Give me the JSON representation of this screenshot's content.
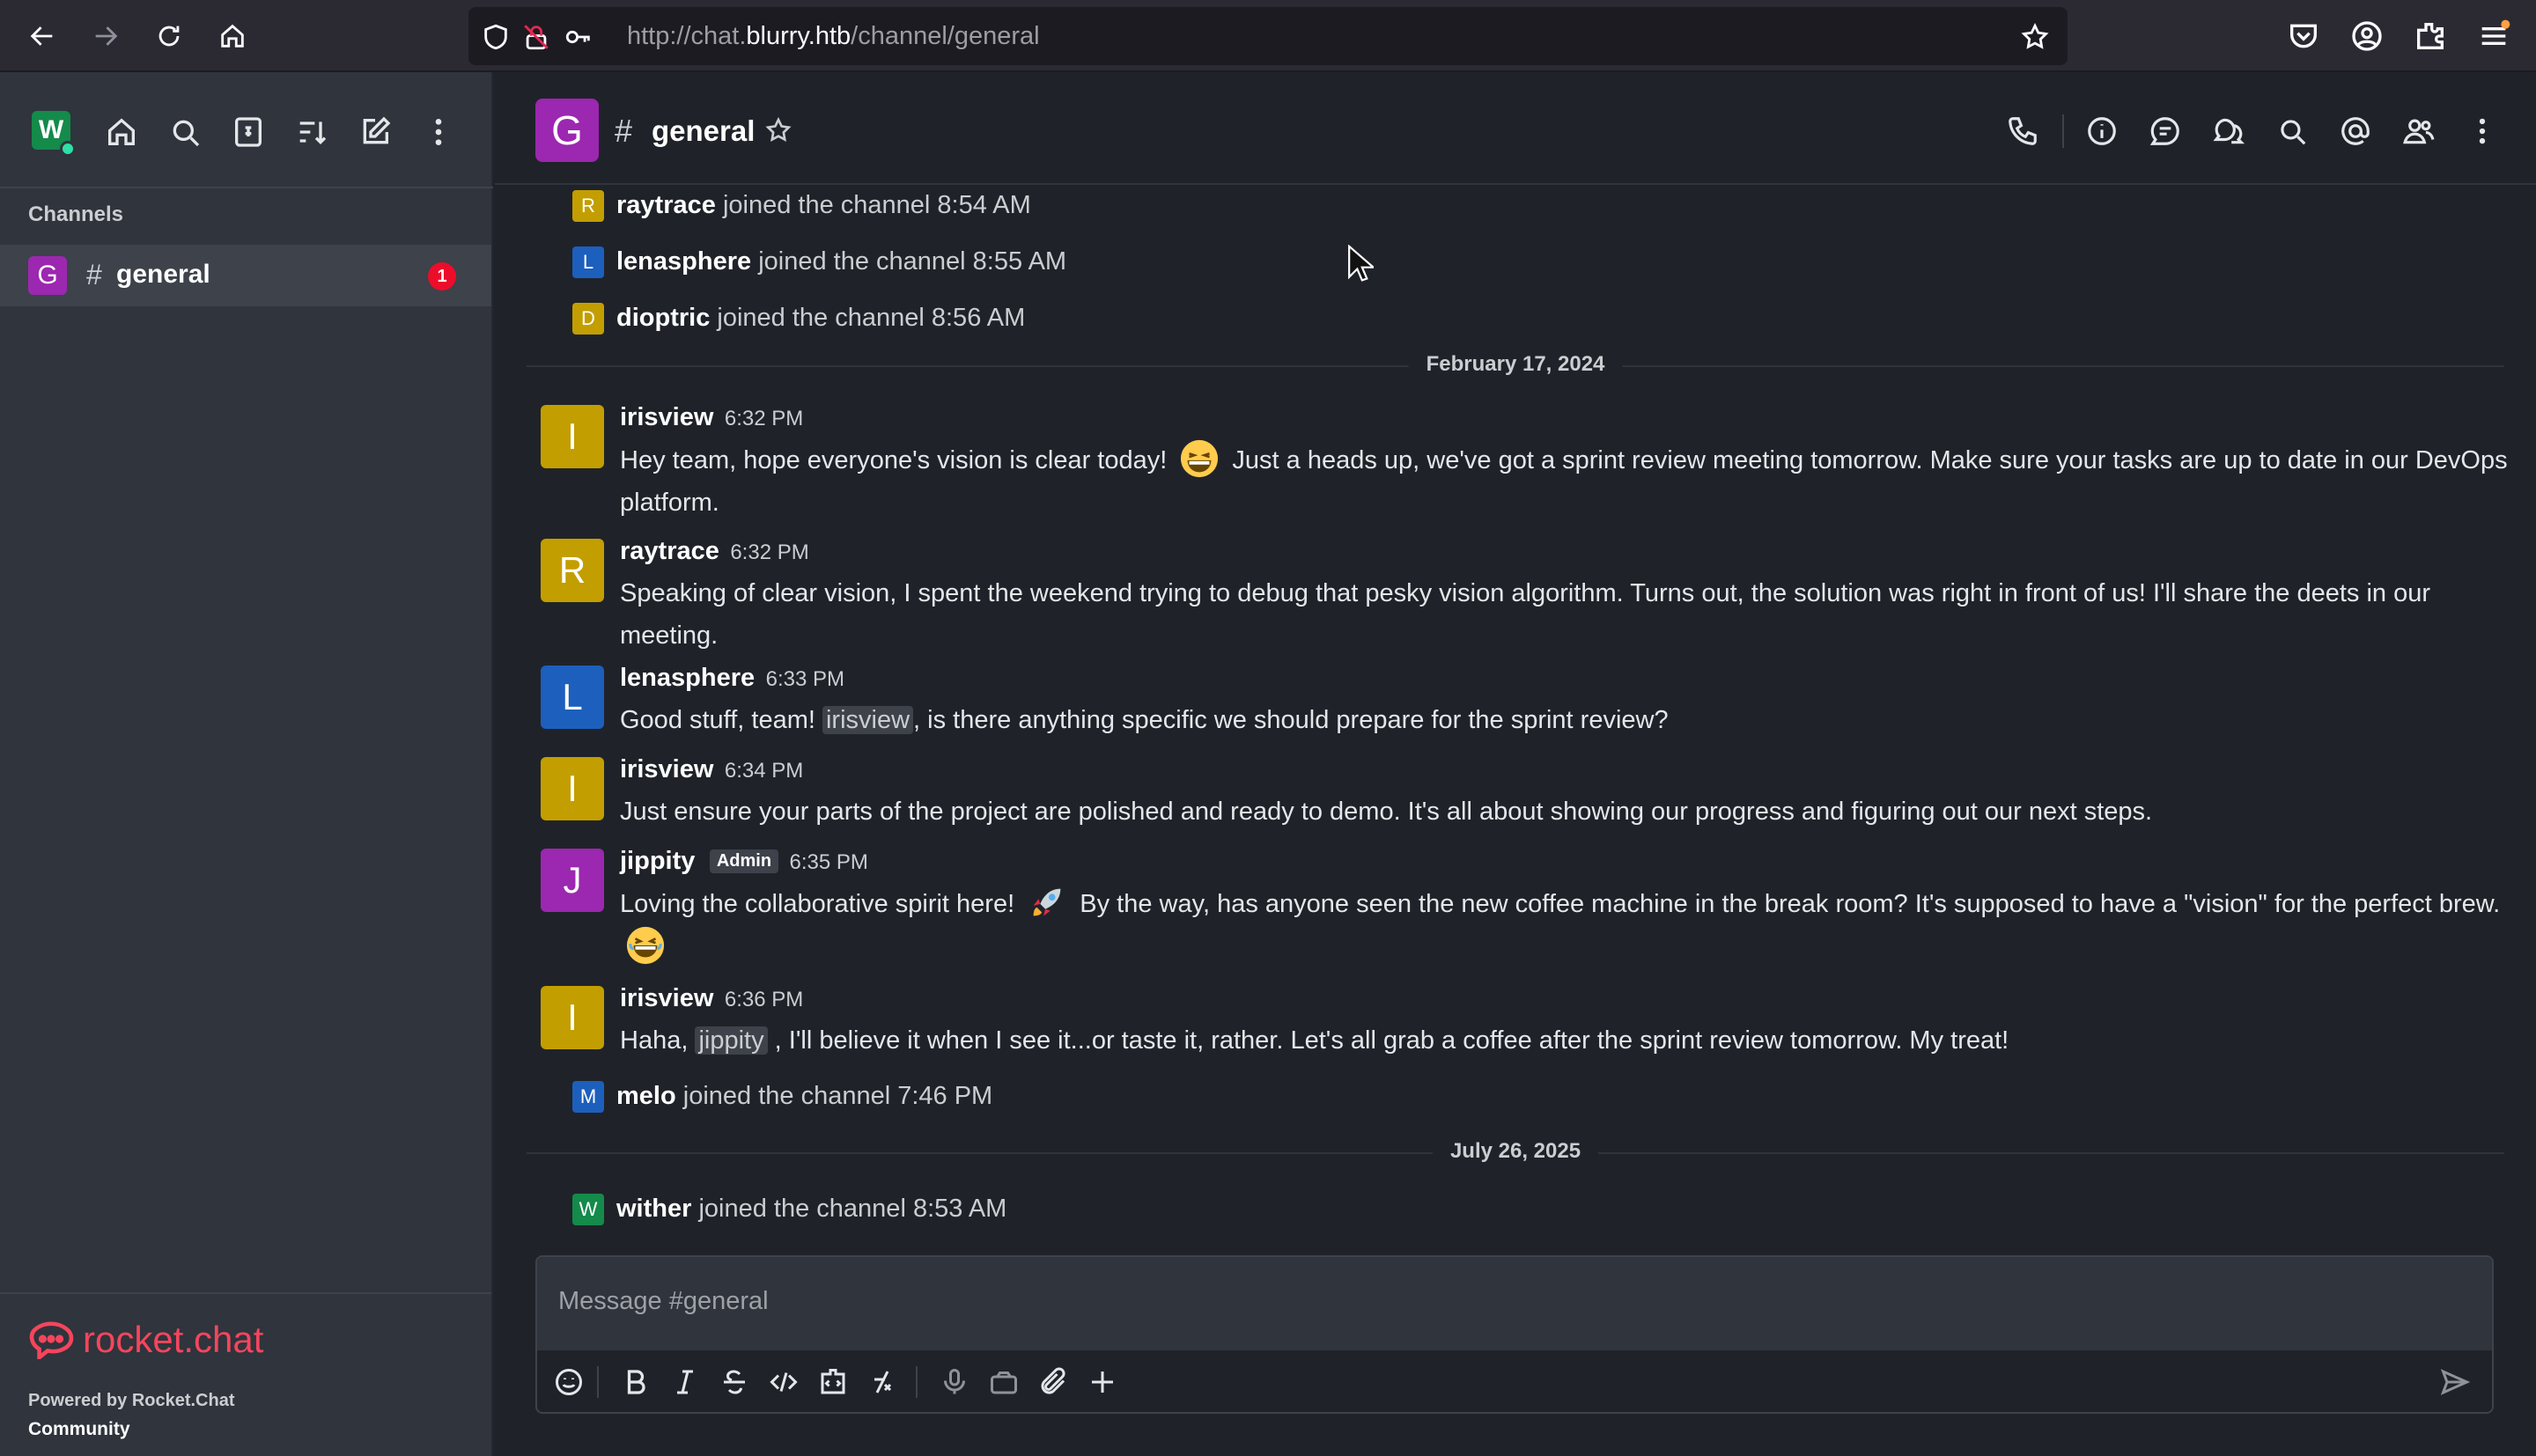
{
  "browser": {
    "url_prefix": "http://chat.",
    "url_host": "blurry.htb",
    "url_path": "/channel/general"
  },
  "sidebar": {
    "user_initial": "W",
    "section_label": "Channels",
    "channel": {
      "initial": "G",
      "hash": "#",
      "name": "general",
      "badge": "1"
    },
    "footer": {
      "logo_text": "rocket.chat",
      "powered_by": "Powered by Rocket.Chat",
      "edition": "Community"
    }
  },
  "room": {
    "initial": "G",
    "hash": "#",
    "title": "general"
  },
  "messages": {
    "sys1": {
      "initial": "R",
      "user": "raytrace",
      "text": "joined the channel 8:54 AM",
      "color": "#c39e00"
    },
    "sys2": {
      "initial": "L",
      "user": "lenasphere",
      "text": "joined the channel 8:55 AM",
      "color": "#1d5fbd"
    },
    "sys3": {
      "initial": "D",
      "user": "dioptric",
      "text": "joined the channel 8:56 AM",
      "color": "#c39e00"
    },
    "date1": "February 17, 2024",
    "m1": {
      "initial": "I",
      "user": "irisview",
      "time": "6:32 PM",
      "text_a": "Hey team, hope everyone's vision is clear today!",
      "text_b": "Just a heads up, we've got a sprint review meeting tomorrow. Make sure your tasks are up to date in our DevOps platform."
    },
    "m2": {
      "initial": "R",
      "user": "raytrace",
      "time": "6:32 PM",
      "text": "Speaking of clear vision, I spent the weekend trying to debug that pesky vision algorithm. Turns out, the solution was right in front of us! I'll share the deets in our meeting."
    },
    "m3": {
      "initial": "L",
      "user": "lenasphere",
      "time": "6:33 PM",
      "text_a": "Good stuff, team!",
      "mention": "irisview",
      "text_b": ", is there anything specific we should prepare for the sprint review?"
    },
    "m4": {
      "initial": "I",
      "user": "irisview",
      "time": "6:34 PM",
      "text": "Just ensure your parts of the project are polished and ready to demo. It's all about showing our progress and figuring out our next steps."
    },
    "m5": {
      "initial": "J",
      "user": "jippity",
      "role": "Admin",
      "time": "6:35 PM",
      "text_a": "Loving the collaborative spirit here!",
      "text_b": "By the way, has anyone seen the new coffee machine in the break room? It's supposed to have a \"vision\" for the perfect brew."
    },
    "m6": {
      "initial": "I",
      "user": "irisview",
      "time": "6:36 PM",
      "text_a": "Haha,",
      "mention": "jippity",
      "text_b": ", I'll believe it when I see it...or taste it, rather. Let's all grab a coffee after the sprint review tomorrow. My treat!"
    },
    "sys4": {
      "initial": "M",
      "user": "melo",
      "text": "joined the channel 7:46 PM",
      "color": "#1d5fbd"
    },
    "date2": "July 26, 2025",
    "sys5": {
      "initial": "W",
      "user": "wither",
      "text": "joined the channel 8:53 AM",
      "color": "#148a4b"
    }
  },
  "composer": {
    "placeholder": "Message #general"
  },
  "colors": {
    "yellow_avatar": "#c39e00",
    "blue_avatar": "#1d5fbd",
    "purple_avatar": "#9c27b0",
    "green_avatar": "#148a4b",
    "brand": "#f5455c"
  }
}
